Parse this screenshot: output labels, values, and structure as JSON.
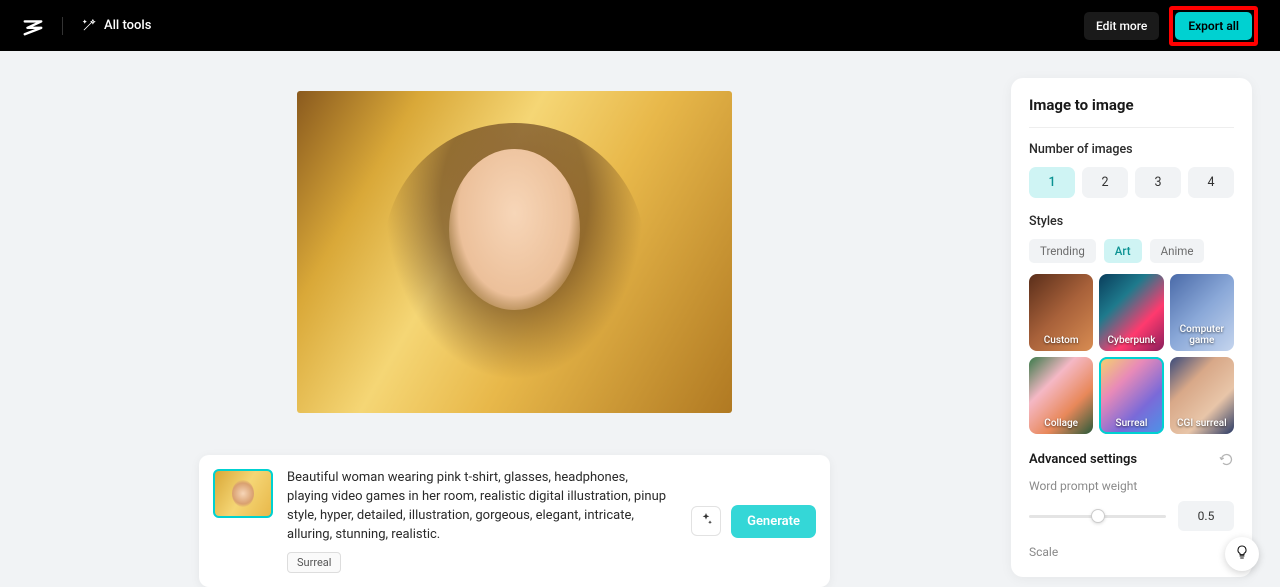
{
  "header": {
    "all_tools": "All tools",
    "edit_more": "Edit more",
    "export_all": "Export all"
  },
  "prompt": {
    "text": "Beautiful woman wearing pink t-shirt, glasses, headphones, playing video games in her room, realistic digital illustration, pinup style, hyper, detailed, illustration, gorgeous, elegant, intricate, alluring, stunning, realistic.",
    "tag": "Surreal",
    "generate": "Generate"
  },
  "panel": {
    "title": "Image to image",
    "number_label": "Number of images",
    "numbers": [
      "1",
      "2",
      "3",
      "4"
    ],
    "number_selected": "1",
    "styles_label": "Styles",
    "tabs": [
      "Trending",
      "Art",
      "Anime"
    ],
    "tab_selected": "Art",
    "style_tiles": [
      "Custom",
      "Cyberpunk",
      "Computer game",
      "Collage",
      "Surreal",
      "CGI surreal"
    ],
    "style_selected": "Surreal",
    "advanced_label": "Advanced settings",
    "word_weight_label": "Word prompt weight",
    "word_weight_value": "0.5",
    "scale_label": "Scale"
  }
}
